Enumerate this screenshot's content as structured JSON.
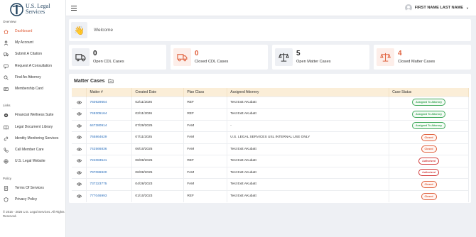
{
  "brand": {
    "line1": "U.S. Legal",
    "line2": "Services"
  },
  "sidebar": {
    "overview_label": "Overview",
    "overview": [
      {
        "label": "Dashboard",
        "icon": "home-icon"
      },
      {
        "label": "My Account",
        "icon": "user-icon"
      },
      {
        "label": "Submit A Citation",
        "icon": "truck-icon"
      },
      {
        "label": "Request A Consultation",
        "icon": "consult-icon"
      },
      {
        "label": "Find An Attorney",
        "icon": "search-icon"
      },
      {
        "label": "Membership Card",
        "icon": "card-icon"
      }
    ],
    "links_label": "Links",
    "links": [
      {
        "label": "Financial Wellness Suite",
        "icon": "wellness-icon"
      },
      {
        "label": "Legal Document Library",
        "icon": "book-icon"
      },
      {
        "label": "Identity Monitoring Services",
        "icon": "link-icon"
      },
      {
        "label": "Call Member Care",
        "icon": "phone-icon"
      },
      {
        "label": "U.S. Legal Website",
        "icon": "globe-icon"
      }
    ],
    "policy_label": "Policy",
    "policy": [
      {
        "label": "Terms Of Services",
        "icon": "document-icon"
      },
      {
        "label": "Privacy Policy",
        "icon": "shield-icon"
      }
    ],
    "copyright": "© 2016 - 2026 U.S. Legal Services. All Rights Reserved."
  },
  "header": {
    "user_name": "FIRST NAME LAST NAME"
  },
  "welcome": {
    "title": "Welcome"
  },
  "stats": [
    {
      "value": "0",
      "label": "Open CDL Cases",
      "color": "#222222",
      "bg": "#eef0f4"
    },
    {
      "value": "0",
      "label": "Closed CDL Cases",
      "color": "#e0603c",
      "bg": "#fdeee9"
    },
    {
      "value": "5",
      "label": "Open Matter Cases",
      "color": "#222222",
      "bg": "#eef0f4"
    },
    {
      "value": "4",
      "label": "Closed Matter Cases",
      "color": "#e0603c",
      "bg": "#fdeee9"
    }
  ],
  "matter": {
    "title": "Matter Cases",
    "columns": [
      "",
      "Matter #",
      "Created Date",
      "Plan Class",
      "Assigned Attorney",
      "Case Status"
    ],
    "rows": [
      {
        "no": "760929664",
        "date": "02/11/2026",
        "plan": "REF",
        "attorney": "Test Extt AKubatt",
        "status": "Assigned To Attorney",
        "kind": "assigned"
      },
      {
        "no": "748305164",
        "date": "02/11/2026",
        "plan": "REF",
        "attorney": "Test Extt AKubatt",
        "status": "Assigned To Attorney",
        "kind": "assigned"
      },
      {
        "no": "647380914",
        "date": "07/29/2025",
        "plan": "FAM",
        "attorney": "-",
        "status": "Assigned To Attorney",
        "kind": "assigned"
      },
      {
        "no": "765864629",
        "date": "07/11/2025",
        "plan": "FAM",
        "attorney": "U.S. LEGAL SERVICES USL INTERNAL USE ONLY",
        "status": "Closed",
        "kind": "closed"
      },
      {
        "no": "742566836",
        "date": "06/10/2025",
        "plan": "FAM",
        "attorney": "Test Extt AKubatt",
        "status": "Closed",
        "kind": "closed"
      },
      {
        "no": "724083541",
        "date": "06/08/2025",
        "plan": "REF",
        "attorney": "Test Extt AKubatt",
        "status": "Authorized",
        "kind": "authorized"
      },
      {
        "no": "797086920",
        "date": "06/08/2025",
        "plan": "FAM",
        "attorney": "Test Extt AKubatt",
        "status": "Authorized",
        "kind": "authorized"
      },
      {
        "no": "737323775",
        "date": "04/28/2023",
        "plan": "FAM",
        "attorney": "Test Extt AKubatt",
        "status": "Closed",
        "kind": "closed"
      },
      {
        "no": "777046993",
        "date": "01/10/2023",
        "plan": "REF",
        "attorney": "Test Extt AKubatt",
        "status": "Closed",
        "kind": "closed"
      }
    ]
  },
  "colors": {
    "accent": "#e0603c",
    "link": "#2a6ebb",
    "brand": "#1d3f5c",
    "header_row": "#fbeed8"
  }
}
